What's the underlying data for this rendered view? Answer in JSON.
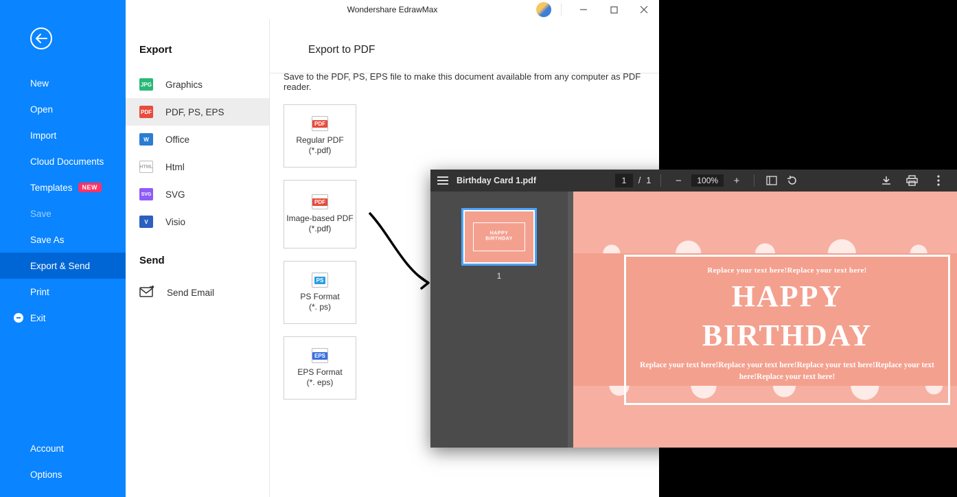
{
  "title": "Wondershare EdrawMax",
  "sidebar": {
    "items": [
      "New",
      "Open",
      "Import",
      "Cloud Documents",
      "Templates",
      "Save",
      "Save As",
      "Export & Send",
      "Print",
      "Exit"
    ],
    "badge": "NEW",
    "bottom": [
      "Account",
      "Options"
    ]
  },
  "col2": {
    "heading": "Export",
    "items": [
      "Graphics",
      "PDF, PS, EPS",
      "Office",
      "Html",
      "SVG",
      "Visio"
    ],
    "send_heading": "Send",
    "send_item": "Send Email"
  },
  "col3": {
    "heading": "Export to PDF",
    "desc": "Save to the PDF, PS, EPS file to make this document available from any computer as PDF reader.",
    "tiles": [
      {
        "l1": "Regular PDF",
        "l2": "(*.pdf)",
        "k": "pdf"
      },
      {
        "l1": "Image-based PDF",
        "l2": "(*.pdf)",
        "k": "pdf"
      },
      {
        "l1": "PS Format",
        "l2": "(*. ps)",
        "k": "ps"
      },
      {
        "l1": "EPS Format",
        "l2": "(*. eps)",
        "k": "eps"
      }
    ]
  },
  "pdf": {
    "filename": "Birthday Card 1.pdf",
    "page": "1",
    "pages": "1",
    "zoom": "100%",
    "thumb_num": "1",
    "card": {
      "top": "Replace your text here!Replace your text here!",
      "h1": "HAPPY",
      "h2": "BIRTHDAY",
      "sub": "Replace your text here!Replace your text here!Replace your text here!Replace your text here!Replace your text here!"
    }
  }
}
